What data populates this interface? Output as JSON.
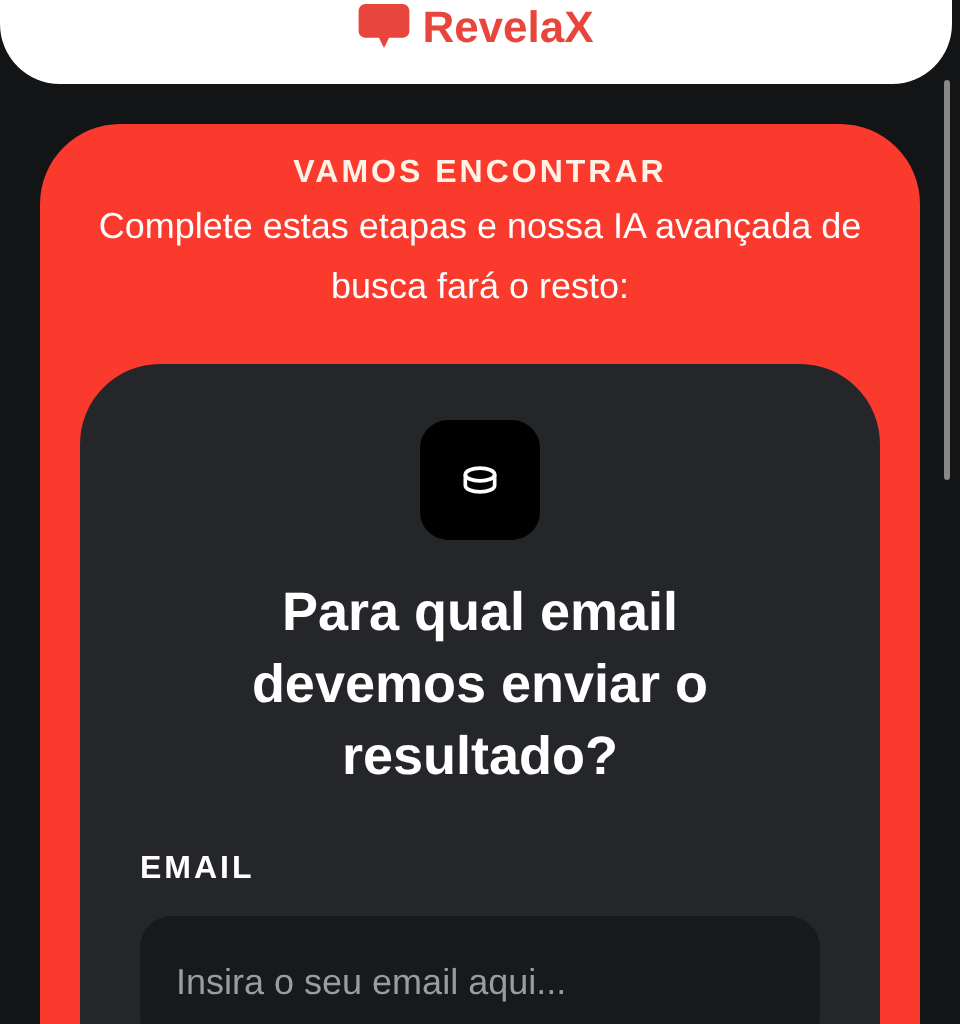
{
  "header": {
    "logo": "RevelaX"
  },
  "intro": {
    "eyebrow": "VAMOS ENCONTRAR",
    "text": "Complete estas etapas e nossa IA avançada de busca fará o resto:"
  },
  "step": {
    "title": "Para qual email devemos enviar o resultado?",
    "field": {
      "label": "EMAIL",
      "placeholder": "Insira o seu email aqui..."
    }
  }
}
